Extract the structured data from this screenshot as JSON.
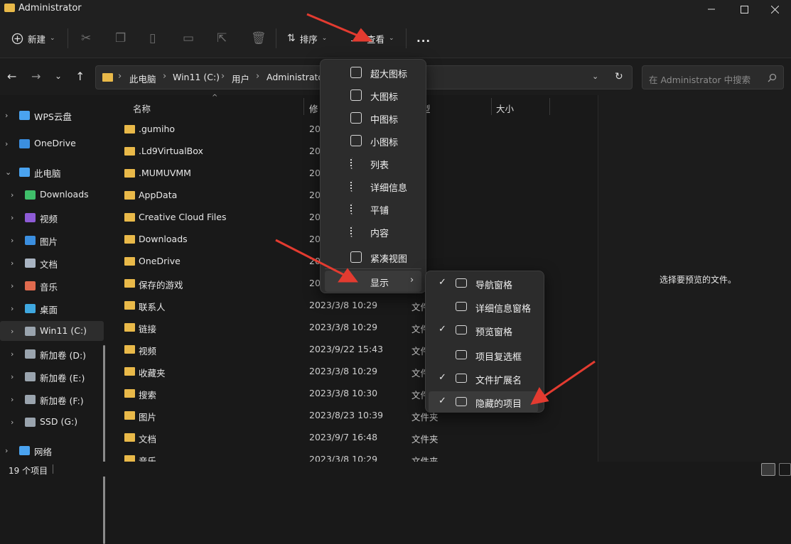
{
  "window": {
    "title": "Administrator"
  },
  "toolbar": {
    "new_label": "新建",
    "sort_label": "排序",
    "view_label": "查看",
    "more_label": "..."
  },
  "address": {
    "crumbs": [
      "此电脑",
      "Win11 (C:)",
      "用户",
      "Administrato"
    ],
    "search_placeholder": "在 Administrator 中搜索"
  },
  "sidebar": {
    "items": [
      {
        "label": "WPS云盘",
        "icon": "cloud-icon",
        "color": "#4aa3f0"
      },
      {
        "label": "OneDrive",
        "icon": "onedrive-icon",
        "color": "#3b8fe0"
      },
      {
        "label": "此电脑",
        "icon": "computer-icon",
        "color": "#4aa3f0"
      },
      {
        "label": "Downloads",
        "icon": "download-icon",
        "color": "#3fbf6a"
      },
      {
        "label": "视频",
        "icon": "video-icon",
        "color": "#8e5bd6"
      },
      {
        "label": "图片",
        "icon": "picture-icon",
        "color": "#3b8fe0"
      },
      {
        "label": "文档",
        "icon": "document-icon",
        "color": "#a9b4c2"
      },
      {
        "label": "音乐",
        "icon": "music-icon",
        "color": "#e06a4e"
      },
      {
        "label": "桌面",
        "icon": "desktop-icon",
        "color": "#3fa8e0"
      },
      {
        "label": "Win11 (C:)",
        "icon": "drive-icon",
        "color": "#9aa4ae"
      },
      {
        "label": "新加卷 (D:)",
        "icon": "drive-icon",
        "color": "#9aa4ae"
      },
      {
        "label": "新加卷 (E:)",
        "icon": "drive-icon",
        "color": "#9aa4ae"
      },
      {
        "label": "新加卷 (F:)",
        "icon": "drive-icon",
        "color": "#9aa4ae"
      },
      {
        "label": "SSD (G:)",
        "icon": "drive-icon",
        "color": "#9aa4ae"
      },
      {
        "label": "网络",
        "icon": "network-icon",
        "color": "#4aa3f0"
      }
    ]
  },
  "columns": {
    "name": "名称",
    "date": "修",
    "type": "型",
    "size": "大小"
  },
  "files": [
    {
      "name": ".gumiho",
      "date": "20",
      "type": "夹"
    },
    {
      "name": ".Ld9VirtualBox",
      "date": "20",
      "type": "夹"
    },
    {
      "name": ".MUMUVMM",
      "date": "20",
      "type": "夹"
    },
    {
      "name": "AppData",
      "date": "20",
      "type": "夹"
    },
    {
      "name": "Creative Cloud Files",
      "date": "20",
      "type": "夹"
    },
    {
      "name": "Downloads",
      "date": "20",
      "type": "夹"
    },
    {
      "name": "OneDrive",
      "date": "20",
      "type": "夹"
    },
    {
      "name": "保存的游戏",
      "date": "20",
      "type": "夹"
    },
    {
      "name": "联系人",
      "date": "2023/3/8 10:29",
      "type": "文件"
    },
    {
      "name": "链接",
      "date": "2023/3/8 10:29",
      "type": "文件"
    },
    {
      "name": "视频",
      "date": "2023/9/22 15:43",
      "type": "文件"
    },
    {
      "name": "收藏夹",
      "date": "2023/3/8 10:29",
      "type": "文件"
    },
    {
      "name": "搜索",
      "date": "2023/3/8 10:30",
      "type": "文件"
    },
    {
      "name": "图片",
      "date": "2023/8/23 10:39",
      "type": "文件夹"
    },
    {
      "name": "文档",
      "date": "2023/9/7 16:48",
      "type": "文件夹"
    },
    {
      "name": "音乐",
      "date": "2023/3/8 10:29",
      "type": "文件夹"
    }
  ],
  "preview": {
    "text": "选择要预览的文件。"
  },
  "status": {
    "count": "19 个项目"
  },
  "view_menu": {
    "items": [
      "超大图标",
      "大图标",
      "中图标",
      "小图标",
      "列表",
      "详细信息",
      "平铺",
      "内容",
      "紧凑视图"
    ],
    "show_label": "显示"
  },
  "show_menu": {
    "items": [
      {
        "label": "导航窗格",
        "checked": "✓"
      },
      {
        "label": "详细信息窗格",
        "checked": ""
      },
      {
        "label": "预览窗格",
        "checked": "✓"
      },
      {
        "label": "项目复选框",
        "checked": ""
      },
      {
        "label": "文件扩展名",
        "checked": "✓"
      },
      {
        "label": "隐藏的项目",
        "checked": "✓"
      }
    ]
  },
  "colors": {
    "accent": "#e33b30",
    "folder": "#e9b949"
  }
}
